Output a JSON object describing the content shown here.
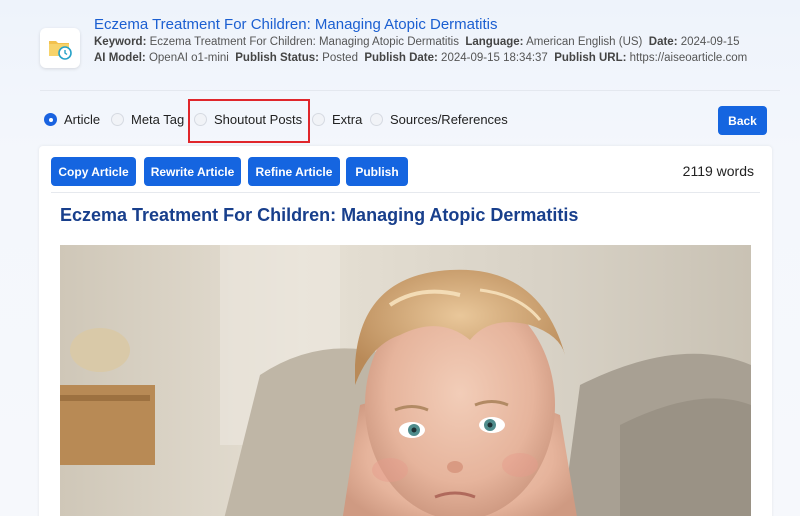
{
  "header": {
    "title": "Eczema Treatment For Children: Managing Atopic Dermatitis",
    "keyword_label": "Keyword:",
    "keyword": "Eczema Treatment For Children: Managing Atopic Dermatitis",
    "language_label": "Language:",
    "language": "American English (US)",
    "date_label": "Date:",
    "date": "2024-09-15",
    "model_label": "AI Model:",
    "model": "OpenAI o1-mini",
    "status_label": "Publish Status:",
    "status": "Posted",
    "publish_date_label": "Publish Date:",
    "publish_date": "2024-09-15 18:34:37",
    "url_label": "Publish URL:",
    "url": "https://aiseoarticle.com",
    "icon": "folder-clock-icon"
  },
  "tabs": [
    {
      "label": "Article",
      "checked": true
    },
    {
      "label": "Meta Tag",
      "checked": false
    },
    {
      "label": "Shoutout Posts",
      "checked": false
    },
    {
      "label": "Extra",
      "checked": false
    },
    {
      "label": "Sources/References",
      "checked": false
    }
  ],
  "back_label": "Back",
  "toolbar": {
    "copy": "Copy Article",
    "rewrite": "Rewrite Article",
    "refine": "Refine Article",
    "publish": "Publish"
  },
  "word_count": "2119 words",
  "article_title": "Eczema Treatment For Children: Managing Atopic Dermatitis",
  "colors": {
    "primary": "#1565e0",
    "title_link": "#1b5fd1",
    "article_title": "#183f8c",
    "highlight": "#e0262b"
  }
}
